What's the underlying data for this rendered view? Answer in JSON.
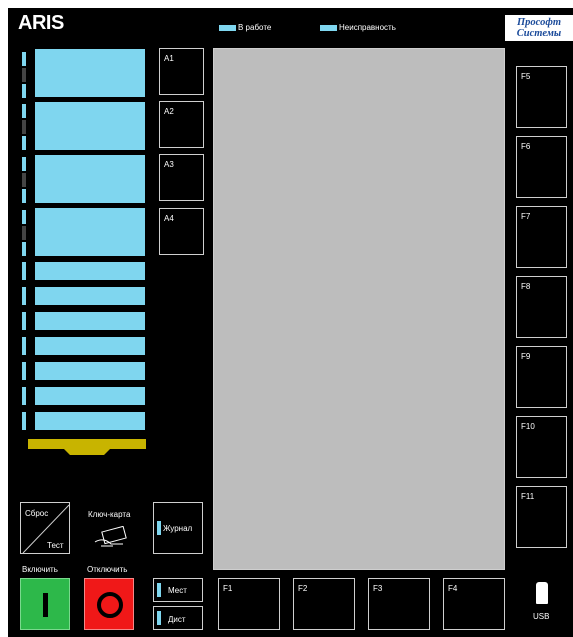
{
  "header": {
    "title": "ARIS",
    "legend": [
      {
        "label": "В работе",
        "color": "#7fd6ef"
      },
      {
        "label": "Неисправность",
        "color": "#7fd6ef"
      }
    ],
    "logo_line1": "Прософт",
    "logo_line2": "Системы"
  },
  "a_slots": [
    "A1",
    "A2",
    "A3",
    "A4"
  ],
  "f_right": [
    "F5",
    "F6",
    "F7",
    "F8",
    "F9",
    "F10",
    "F11"
  ],
  "f_bottom": [
    "F1",
    "F2",
    "F3",
    "F4"
  ],
  "controls": {
    "reset_top": "Сброс",
    "reset_bottom": "Тест",
    "key_card": "Ключ-карта",
    "journal": "Журнал",
    "on_label": "Включить",
    "off_label": "Отключить",
    "on_symbol": "I",
    "off_symbol": "O",
    "local": "Мест",
    "remote": "Дист",
    "usb": "USB"
  },
  "colors": {
    "accent": "#7fd6ef",
    "screen": "#bdbdbd",
    "green": "#2db84a",
    "red": "#f01818",
    "tray": "#c8b400"
  }
}
